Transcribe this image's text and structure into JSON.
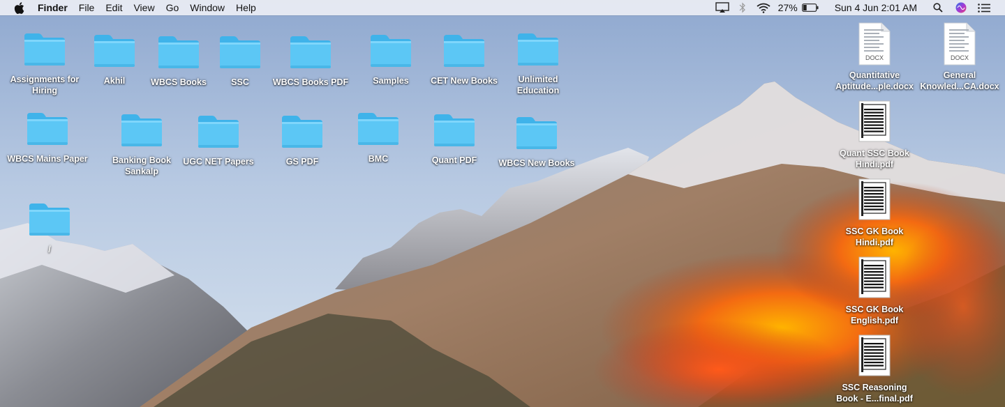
{
  "menubar": {
    "app_name": "Finder",
    "menus": [
      "File",
      "Edit",
      "View",
      "Go",
      "Window",
      "Help"
    ],
    "battery_percent": "27%",
    "battery_level": 0.27,
    "clock": "Sun 4 Jun  2:01 AM"
  },
  "desktop": {
    "folders": [
      {
        "label": "Assignments for\nHiring"
      },
      {
        "label": "Akhil"
      },
      {
        "label": "WBCS Books"
      },
      {
        "label": "SSC"
      },
      {
        "label": "WBCS Books PDF"
      },
      {
        "label": "Samples"
      },
      {
        "label": "CET New Books"
      },
      {
        "label": "Unlimited\nEducation"
      },
      {
        "label": "WBCS Mains Paper"
      },
      {
        "label": "Banking Book\nSankalp"
      },
      {
        "label": "UGC NET Papers"
      },
      {
        "label": "GS PDF"
      },
      {
        "label": "BMC"
      },
      {
        "label": "Quant PDF"
      },
      {
        "label": "WBCS New Books"
      },
      {
        "label": "/"
      }
    ],
    "files": [
      {
        "label": "Quantitative\nAptitude...ple.docx",
        "badge": "DOCX",
        "kind": "docx"
      },
      {
        "label": "General\nKnowled...CA.docx",
        "badge": "DOCX",
        "kind": "docx"
      },
      {
        "label": "Quant SSC Book\nHindi.pdf",
        "kind": "pdf"
      },
      {
        "label": "SSC GK Book\nHindi.pdf",
        "kind": "pdf"
      },
      {
        "label": "SSC GK Book\nEnglish.pdf",
        "kind": "pdf"
      },
      {
        "label": "SSC Reasoning\nBook - E...final.pdf",
        "kind": "pdf"
      }
    ]
  }
}
